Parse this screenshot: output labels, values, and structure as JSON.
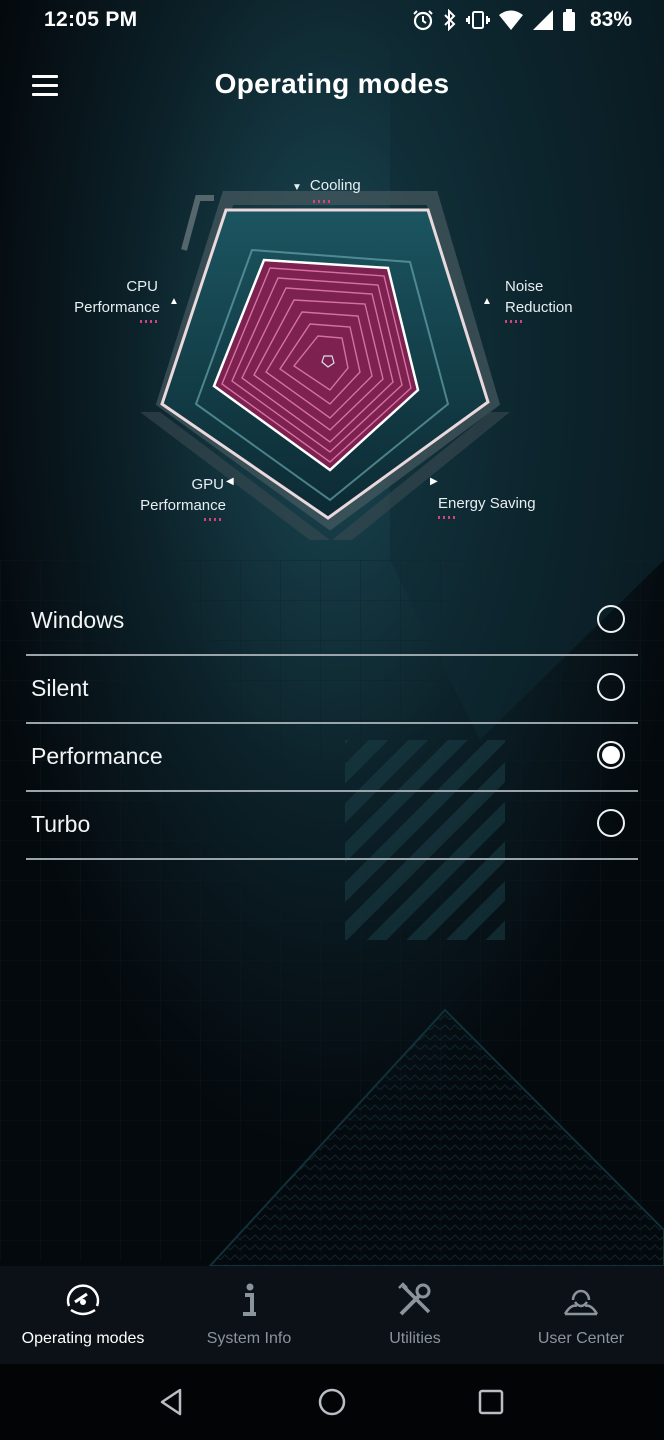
{
  "status_bar": {
    "time": "12:05 PM",
    "battery_percent": "83%",
    "icons": [
      "alarm-icon",
      "bluetooth-icon",
      "vibrate-icon",
      "wifi-icon",
      "signal-icon",
      "battery-icon"
    ]
  },
  "header": {
    "title": "Operating modes",
    "menu_icon": "hamburger-menu-icon"
  },
  "radar": {
    "labels": {
      "cooling": "Cooling",
      "cpu_line1": "CPU",
      "cpu_line2": "Performance",
      "noise_line1": "Noise",
      "noise_line2": "Reduction",
      "gpu_line1": "GPU",
      "gpu_line2": "Performance",
      "energy": "Energy Saving"
    }
  },
  "modes": [
    {
      "label": "Windows",
      "selected": false
    },
    {
      "label": "Silent",
      "selected": false
    },
    {
      "label": "Performance",
      "selected": true
    },
    {
      "label": "Turbo",
      "selected": false
    }
  ],
  "bottom_nav": [
    {
      "label": "Operating modes",
      "icon": "speedometer-icon",
      "active": true
    },
    {
      "label": "System Info",
      "icon": "info-icon",
      "active": false
    },
    {
      "label": "Utilities",
      "icon": "tools-icon",
      "active": false
    },
    {
      "label": "User Center",
      "icon": "user-icon",
      "active": false
    }
  ],
  "system_nav": {
    "back_icon": "back-icon",
    "home_icon": "home-icon",
    "recents_icon": "recents-icon"
  },
  "colors": {
    "background": "#04090d",
    "accent_pink": "#d0447e",
    "accent_teal": "#2a6d78",
    "nav_inactive": "#8c949b"
  }
}
